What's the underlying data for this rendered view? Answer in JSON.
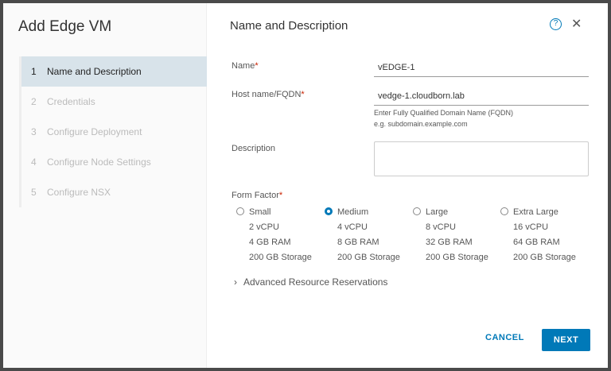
{
  "wizard": {
    "title": "Add Edge VM",
    "steps": [
      {
        "num": "1",
        "label": "Name and Description"
      },
      {
        "num": "2",
        "label": "Credentials"
      },
      {
        "num": "3",
        "label": "Configure Deployment"
      },
      {
        "num": "4",
        "label": "Configure Node Settings"
      },
      {
        "num": "5",
        "label": "Configure NSX"
      }
    ]
  },
  "page": {
    "heading": "Name and Description",
    "help": "?",
    "close": "✕"
  },
  "form": {
    "name_label": "Name",
    "name_value": "vEDGE-1",
    "host_label": "Host name/FQDN",
    "host_value": "vedge-1.cloudborn.lab",
    "host_hint1": "Enter Fully Qualified Domain Name (FQDN)",
    "host_hint2": "e.g. subdomain.example.com",
    "desc_label": "Description",
    "desc_value": "",
    "required": "*",
    "form_factor_label": "Form Factor",
    "form_factors": [
      {
        "name": "Small",
        "cpu": "2 vCPU",
        "ram": "4 GB RAM",
        "storage": "200 GB Storage",
        "selected": false
      },
      {
        "name": "Medium",
        "cpu": "4 vCPU",
        "ram": "8 GB RAM",
        "storage": "200 GB Storage",
        "selected": true
      },
      {
        "name": "Large",
        "cpu": "8 vCPU",
        "ram": "32 GB RAM",
        "storage": "200 GB Storage",
        "selected": false
      },
      {
        "name": "Extra Large",
        "cpu": "16 vCPU",
        "ram": "64 GB RAM",
        "storage": "200 GB Storage",
        "selected": false
      }
    ],
    "advanced": "Advanced Resource Reservations"
  },
  "footer": {
    "cancel": "CANCEL",
    "next": "NEXT"
  }
}
